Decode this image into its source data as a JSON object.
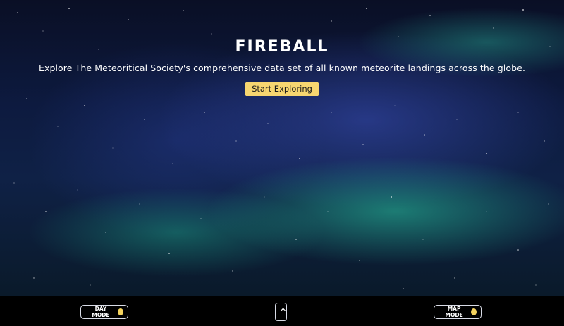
{
  "hero": {
    "title": "FIREBALL",
    "subtitle": "Explore The Meteoritical Society's comprehensive data set of all known meteorite landings across the globe.",
    "cta_label": "Start Exploring"
  },
  "footer": {
    "day_mode_label": "DAY MODE",
    "scroll_top_label": "^",
    "map_mode_label": "MAP MODE"
  },
  "colors": {
    "accent": "#f7d670",
    "toggle_dot": "#f3d25e",
    "footer_bg": "#000000"
  },
  "icons": {
    "day_mode": "sun-toggle-icon",
    "map_mode": "map-toggle-icon",
    "scroll_top": "caret-up-icon"
  }
}
